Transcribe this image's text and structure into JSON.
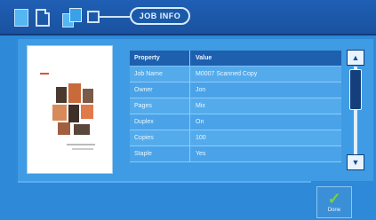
{
  "header": {
    "tab_label": "JOB INFO",
    "step_icons": [
      "document-icon",
      "blank-document-icon",
      "combine-documents-icon",
      "box-icon"
    ]
  },
  "preview": {
    "icon": "page-thumbnail"
  },
  "table": {
    "headers": [
      "Property",
      "Value"
    ],
    "rows": [
      {
        "property": "Job Name",
        "value": "M0007 Scanned Copy"
      },
      {
        "property": "Owner",
        "value": "Jon"
      },
      {
        "property": "Pages",
        "value": "Mix"
      },
      {
        "property": "Duplex",
        "value": "On"
      },
      {
        "property": "Copies",
        "value": "100"
      },
      {
        "property": "Staple",
        "value": "Yes"
      }
    ]
  },
  "scrollbar": {
    "up_icon": "up-arrow-icon",
    "down_icon": "down-arrow-icon"
  },
  "done_button": {
    "label": "Done",
    "icon": "checkmark-icon"
  },
  "colors": {
    "background": "#2e89d8",
    "header": "#1f5fb4",
    "accent_green": "#7ad13f"
  }
}
